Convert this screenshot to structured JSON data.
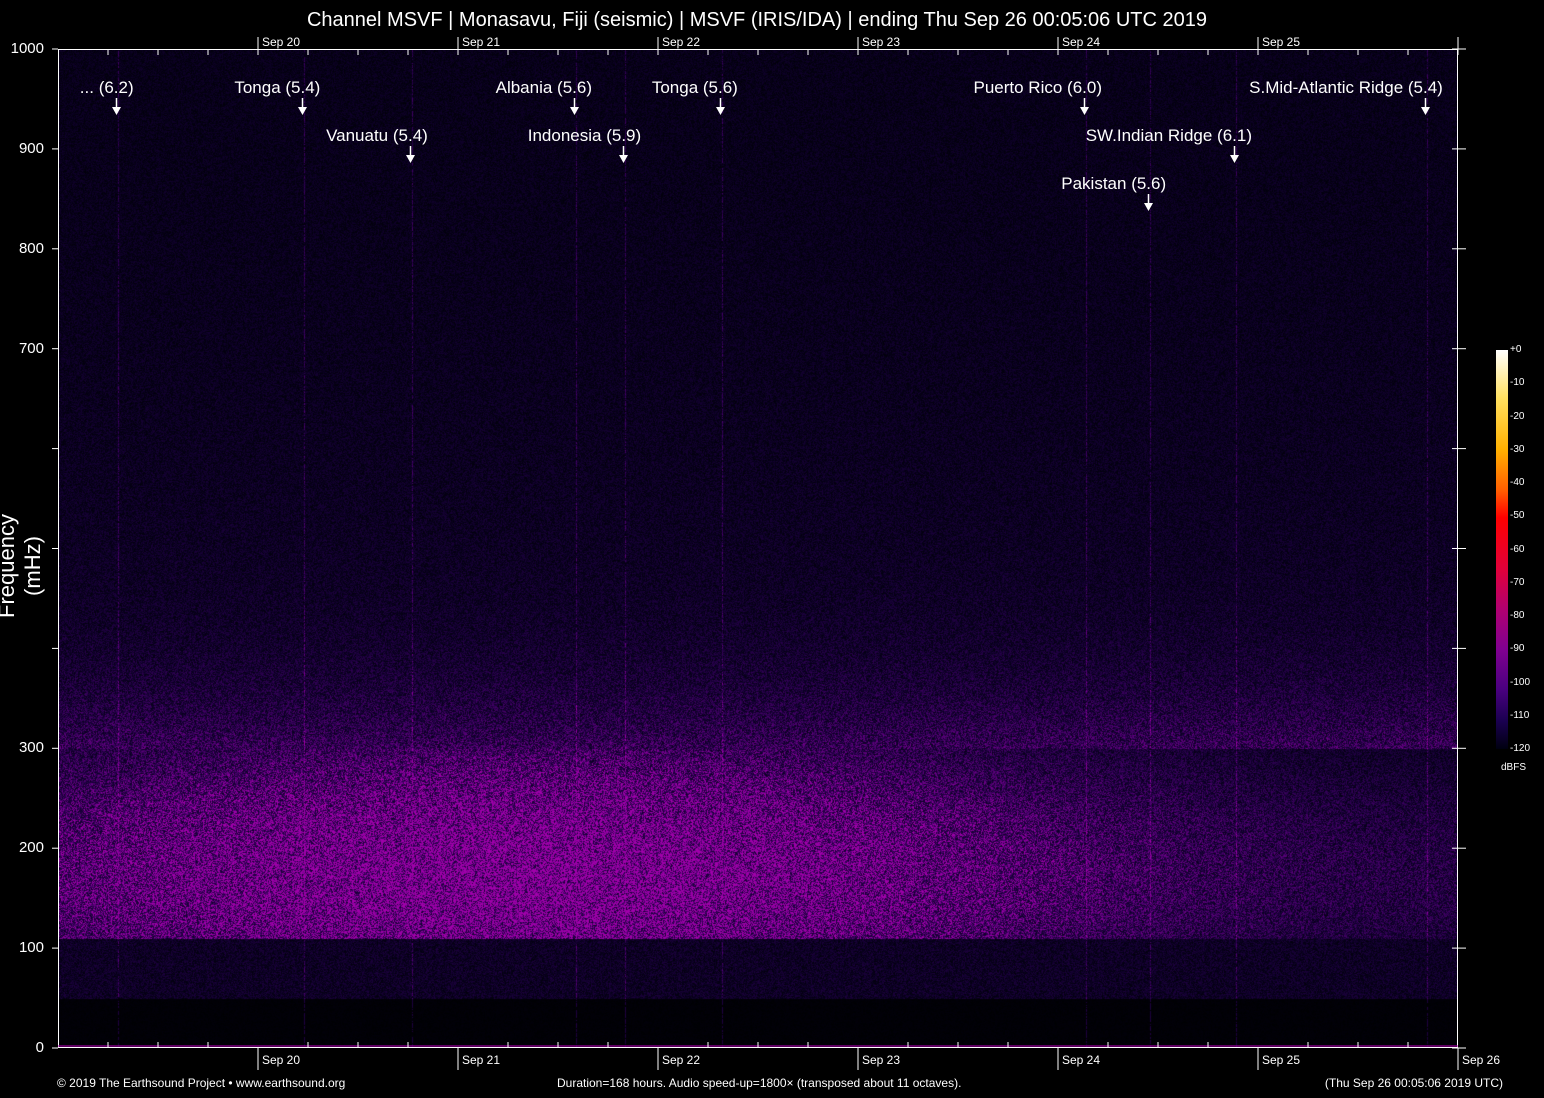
{
  "title": "Channel MSVF | Monasavu, Fiji (seismic) | MSVF (IRIS/IDA) | ending Thu Sep 26 00:05:06 UTC 2019",
  "footer": {
    "left": "© 2019 The Earthsound Project • www.earthsound.org",
    "center": "Duration=168 hours. Audio speed-up=1800× (transposed about 11 octaves).",
    "right": "(Thu Sep 26 00:05:06 2019 UTC)"
  },
  "colors": {
    "background": "#000000",
    "axis": "#ffffff",
    "baseline": "#c000c0"
  },
  "chart_data": {
    "type": "heatmap",
    "title": "Channel MSVF | Monasavu, Fiji (seismic) | MSVF (IRIS/IDA) | ending Thu Sep 26 00:05:06 UTC 2019",
    "ylabel": "Frequency (mHz)",
    "xlabel": "",
    "ylim": [
      0,
      1000
    ],
    "xlim_hours": [
      0,
      168
    ],
    "y_ticks": [
      0,
      100,
      200,
      300,
      400,
      500,
      600,
      700,
      800,
      900,
      1000
    ],
    "y_tick_labels": [
      "0",
      "100",
      "200",
      "300",
      "",
      "",
      "",
      "700",
      "800",
      "900",
      "1000"
    ],
    "x_ticks_hours": [
      24,
      48,
      72,
      96,
      120,
      144,
      168
    ],
    "x_tick_labels_top": [
      "Sep 20",
      "Sep 21",
      "Sep 22",
      "Sep 23",
      "Sep 24",
      "Sep 25"
    ],
    "x_tick_labels_bottom": [
      "Sep 20",
      "Sep 21",
      "Sep 22",
      "Sep 23",
      "Sep 24",
      "Sep 25",
      "Sep 26"
    ],
    "colorbar": {
      "label": "dBFS",
      "ticks": [
        "+0",
        "-10",
        "-20",
        "-30",
        "-40",
        "-50",
        "-60",
        "-70",
        "-80",
        "-90",
        "-100",
        "-110",
        "-120"
      ],
      "range": [
        -120,
        0
      ]
    },
    "events": [
      {
        "label": "... (6.2)",
        "hour": 6.8,
        "row": 1
      },
      {
        "label": "Tonga (5.4)",
        "hour": 29.2,
        "row": 1
      },
      {
        "label": "Vanuatu (5.4)",
        "hour": 42.1,
        "row": 2
      },
      {
        "label": "Albania (5.6)",
        "hour": 61.8,
        "row": 1
      },
      {
        "label": "Indonesia (5.9)",
        "hour": 67.7,
        "row": 2
      },
      {
        "label": "Tonga (5.6)",
        "hour": 79.3,
        "row": 1
      },
      {
        "label": "Puerto Rico (6.0)",
        "hour": 123.0,
        "row": 1
      },
      {
        "label": "Pakistan (5.6)",
        "hour": 130.7,
        "row": 3
      },
      {
        "label": "SW.Indian Ridge (6.1)",
        "hour": 141.0,
        "row": 2
      },
      {
        "label": "S.Mid-Atlantic Ridge (5.4)",
        "hour": 163.9,
        "row": 1
      }
    ]
  }
}
